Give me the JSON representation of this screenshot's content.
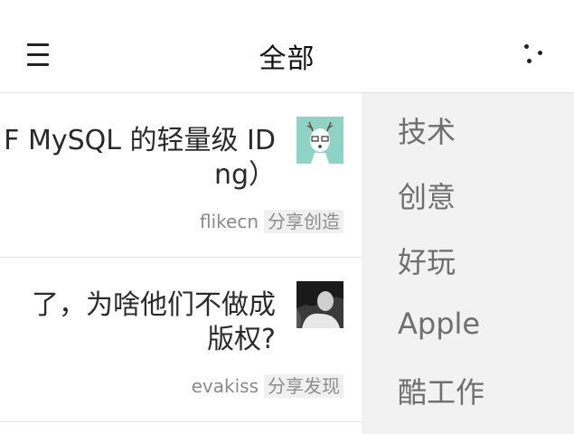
{
  "header": {
    "title": "全部",
    "menu_icon": "hamburger-menu-icon",
    "more_icon": "more-dots-icon"
  },
  "topics": [
    {
      "title_line1": "F MySQL 的轻量级 ID",
      "title_line2": "ng）",
      "author": "flikecn",
      "node": "分享创造",
      "avatar": "deer-avatar"
    },
    {
      "title_line1": "了，为啥他们不做成",
      "title_line2": "版权?",
      "author": "evakiss",
      "node": "分享发现",
      "avatar": "photo-avatar"
    }
  ],
  "dropdown": {
    "items": [
      "技术",
      "创意",
      "好玩",
      "Apple",
      "酷工作"
    ]
  }
}
